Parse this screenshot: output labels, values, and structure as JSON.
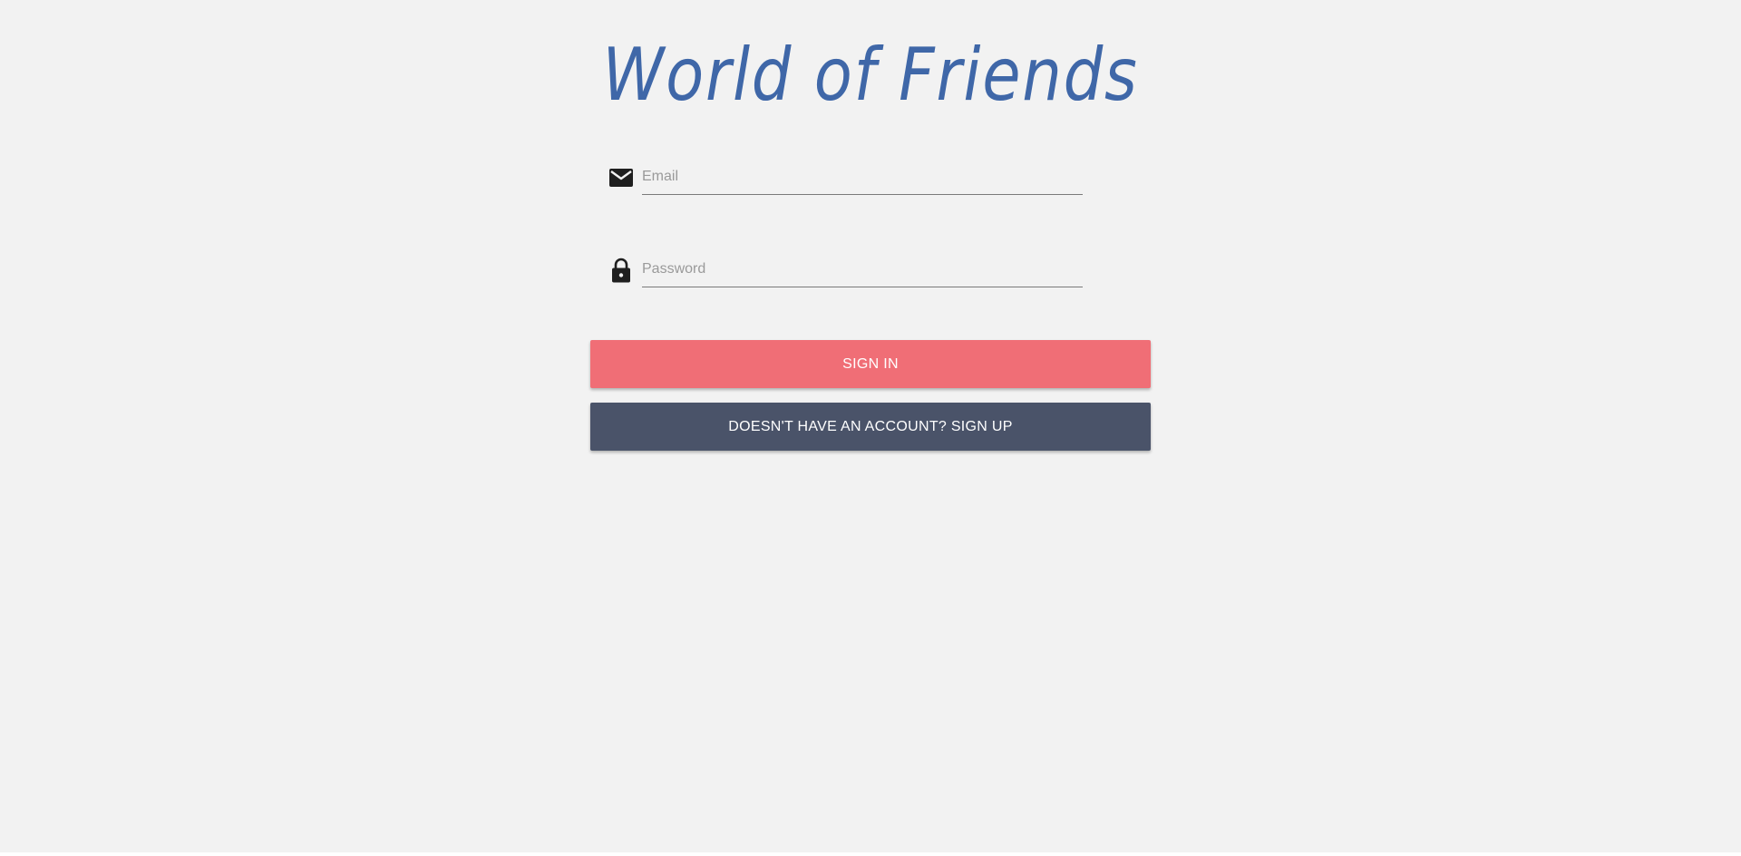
{
  "app": {
    "title": "World of Friends"
  },
  "form": {
    "email": {
      "placeholder": "Email",
      "value": "",
      "icon": "mail-icon"
    },
    "password": {
      "placeholder": "Password",
      "value": "",
      "icon": "lock-icon"
    },
    "sign_in_label": "SIGN IN",
    "sign_up_label": "DOESN'T HAVE AN ACCOUNT? SIGN UP"
  },
  "colors": {
    "background": "#f2f2f2",
    "title": "#3f67a8",
    "sign_in_button": "#f06e76",
    "sign_up_button": "#4a5369",
    "icon": "#1f1f1f"
  }
}
